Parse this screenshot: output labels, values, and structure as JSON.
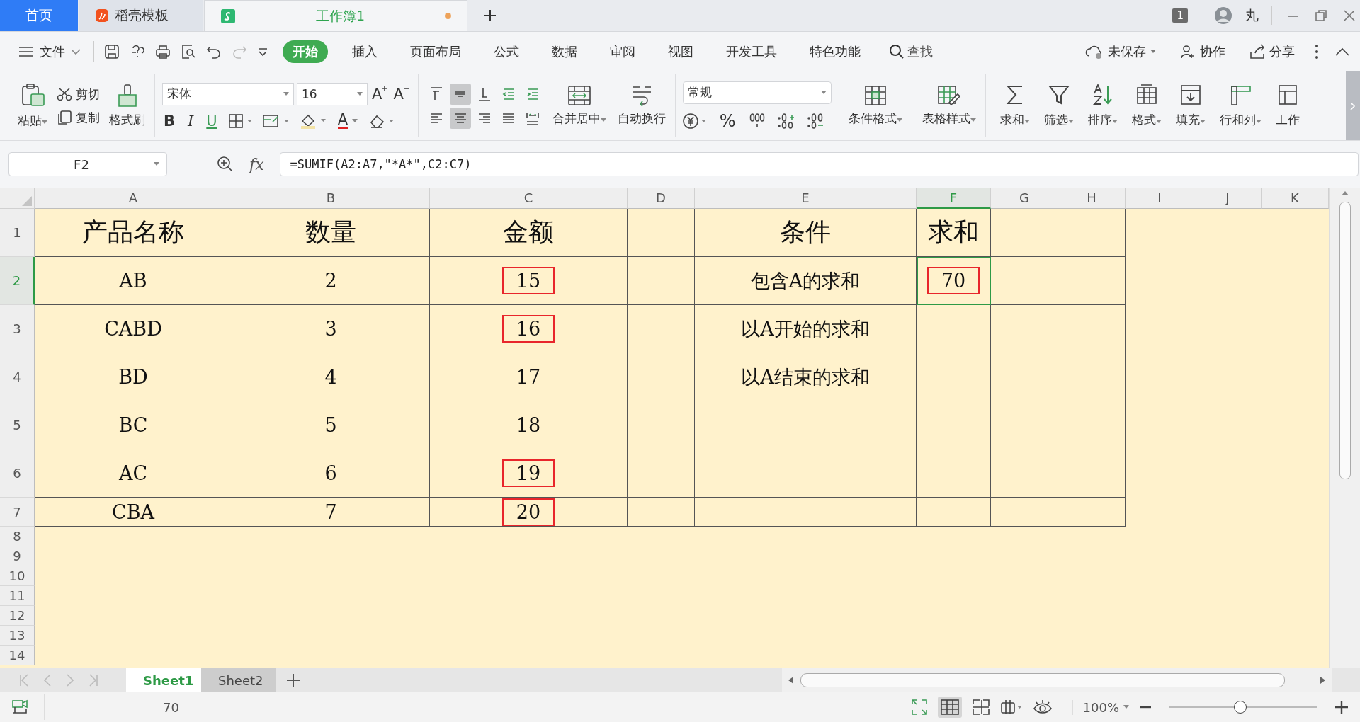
{
  "tabs": [
    {
      "label": "首页",
      "kind": "home",
      "selected": false,
      "unsaved": false
    },
    {
      "label": "稻壳模板",
      "kind": "template",
      "selected": false,
      "unsaved": false
    },
    {
      "label": "工作簿1",
      "kind": "sheet",
      "selected": true,
      "unsaved": true
    }
  ],
  "account": {
    "window_count": "1",
    "user": "丸"
  },
  "file_menu": "文件",
  "menu": [
    {
      "label": "开始",
      "selected": true
    },
    {
      "label": "插入",
      "selected": false
    },
    {
      "label": "页面布局",
      "selected": false
    },
    {
      "label": "公式",
      "selected": false
    },
    {
      "label": "数据",
      "selected": false
    },
    {
      "label": "审阅",
      "selected": false
    },
    {
      "label": "视图",
      "selected": false
    },
    {
      "label": "开发工具",
      "selected": false
    },
    {
      "label": "特色功能",
      "selected": false
    }
  ],
  "search": "查找",
  "cloud": {
    "status": "未保存",
    "collaborate": "协作",
    "share": "分享"
  },
  "ribbon": {
    "paste": "粘贴",
    "cut": "剪切",
    "copy": "复制",
    "format_painter": "格式刷",
    "font": "宋体",
    "size": "16",
    "grow": "A",
    "shrink": "A",
    "bold": "B",
    "italic": "I",
    "underline": "U",
    "font_color": "A",
    "align_top": [
      {
        "selected": false
      },
      {
        "selected": true
      },
      {
        "selected": false
      },
      {
        "selected": false
      },
      {
        "selected": false
      }
    ],
    "align_bottom": [
      {
        "selected": false
      },
      {
        "selected": true
      },
      {
        "selected": false
      },
      {
        "selected": false
      },
      {
        "selected": false
      }
    ],
    "merge": "合并居中",
    "wrap": "自动换行",
    "number_format": "常规",
    "percent": "%",
    "cond_format": "条件格式",
    "table_style": "表格样式",
    "tools": [
      "求和",
      "筛选",
      "排序",
      "格式",
      "填充",
      "行和列",
      "工作"
    ]
  },
  "formula_bar": {
    "cell": "F2",
    "fx": "fx",
    "formula": "=SUMIF(A2:A7,\"*A*\",C2:C7)"
  },
  "columns": [
    {
      "label": "A",
      "selected": false
    },
    {
      "label": "B",
      "selected": false
    },
    {
      "label": "C",
      "selected": false
    },
    {
      "label": "D",
      "selected": false
    },
    {
      "label": "E",
      "selected": false
    },
    {
      "label": "F",
      "selected": true
    },
    {
      "label": "G",
      "selected": false
    },
    {
      "label": "H",
      "selected": false
    },
    {
      "label": "I",
      "selected": false
    },
    {
      "label": "J",
      "selected": false
    },
    {
      "label": "K",
      "selected": false
    }
  ],
  "row_headers": [
    {
      "label": "1",
      "selected": false
    },
    {
      "label": "2",
      "selected": true
    },
    {
      "label": "3",
      "selected": false
    },
    {
      "label": "4",
      "selected": false
    },
    {
      "label": "5",
      "selected": false
    },
    {
      "label": "6",
      "selected": false
    },
    {
      "label": "7",
      "selected": false
    },
    {
      "label": "8",
      "selected": false
    },
    {
      "label": "9",
      "selected": false
    },
    {
      "label": "10",
      "selected": false
    },
    {
      "label": "11",
      "selected": false
    },
    {
      "label": "12",
      "selected": false
    },
    {
      "label": "13",
      "selected": false
    },
    {
      "label": "14",
      "selected": false
    }
  ],
  "rows": [
    [
      {
        "text": "产品名称",
        "marked": false,
        "selected": false
      },
      {
        "text": "数量",
        "marked": false,
        "selected": false
      },
      {
        "text": "金额",
        "marked": false,
        "selected": false
      },
      null,
      {
        "text": "条件",
        "marked": false,
        "selected": false
      },
      {
        "text": "求和",
        "marked": false,
        "selected": false
      },
      null,
      null
    ],
    [
      {
        "text": "AB",
        "marked": false,
        "selected": false
      },
      {
        "text": "2",
        "marked": false,
        "selected": false
      },
      {
        "text": "15",
        "marked": true,
        "selected": false
      },
      null,
      {
        "text": "包含A的求和",
        "marked": false,
        "selected": false
      },
      {
        "text": "70",
        "marked": true,
        "selected": true
      },
      null,
      null
    ],
    [
      {
        "text": "CABD",
        "marked": false,
        "selected": false
      },
      {
        "text": "3",
        "marked": false,
        "selected": false
      },
      {
        "text": "16",
        "marked": true,
        "selected": false
      },
      null,
      {
        "text": "以A开始的求和",
        "marked": false,
        "selected": false
      },
      null,
      null,
      null
    ],
    [
      {
        "text": "BD",
        "marked": false,
        "selected": false
      },
      {
        "text": "4",
        "marked": false,
        "selected": false
      },
      {
        "text": "17",
        "marked": false,
        "selected": false
      },
      null,
      {
        "text": "以A结束的求和",
        "marked": false,
        "selected": false
      },
      null,
      null,
      null
    ],
    [
      {
        "text": "BC",
        "marked": false,
        "selected": false
      },
      {
        "text": "5",
        "marked": false,
        "selected": false
      },
      {
        "text": "18",
        "marked": false,
        "selected": false
      },
      null,
      null,
      null,
      null,
      null
    ],
    [
      {
        "text": "AC",
        "marked": false,
        "selected": false
      },
      {
        "text": "6",
        "marked": false,
        "selected": false
      },
      {
        "text": "19",
        "marked": true,
        "selected": false
      },
      null,
      null,
      null,
      null,
      null
    ],
    [
      {
        "text": "CBA",
        "marked": false,
        "selected": false
      },
      {
        "text": "7",
        "marked": false,
        "selected": false
      },
      {
        "text": "20",
        "marked": true,
        "selected": false
      },
      null,
      null,
      null,
      null,
      null
    ]
  ],
  "sheet_tabs": [
    {
      "label": "Sheet1",
      "selected": true
    },
    {
      "label": "Sheet2",
      "selected": false
    }
  ],
  "status": {
    "value": "70",
    "zoom": "100%",
    "zoom_slider": {
      "level": 0.48
    }
  }
}
